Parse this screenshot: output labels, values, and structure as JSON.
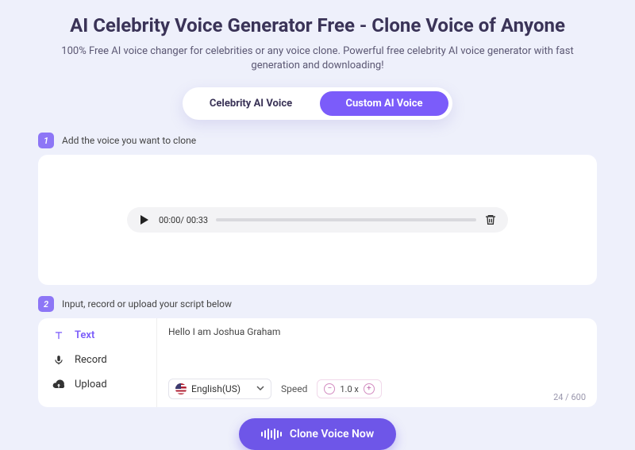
{
  "header": {
    "title": "AI Celebrity Voice Generator Free - Clone Voice of Anyone",
    "subtitle": "100% Free AI voice changer for celebrities or any voice clone. Powerful free celebrity AI voice generator with fast generation and downloading!"
  },
  "mode_toggle": {
    "options": [
      "Celebrity AI Voice",
      "Custom AI Voice"
    ],
    "active_index": 1
  },
  "step1": {
    "badge": "1",
    "label": "Add the voice you want to clone",
    "player": {
      "current": "00:00",
      "total": "00:33"
    }
  },
  "step2": {
    "badge": "2",
    "label": "Input, record or upload your script below",
    "input_modes": [
      {
        "id": "text",
        "label": "Text",
        "active": true
      },
      {
        "id": "record",
        "label": "Record",
        "active": false
      },
      {
        "id": "upload",
        "label": "Upload",
        "active": false
      }
    ],
    "script_text": "Hello I am Joshua Graham",
    "language": {
      "label": "English(US)"
    },
    "speed": {
      "label": "Speed",
      "value": "1.0 x"
    },
    "counter": {
      "used": 24,
      "max": 600,
      "display": "24 / 600"
    }
  },
  "cta": {
    "label": "Clone Voice Now"
  }
}
